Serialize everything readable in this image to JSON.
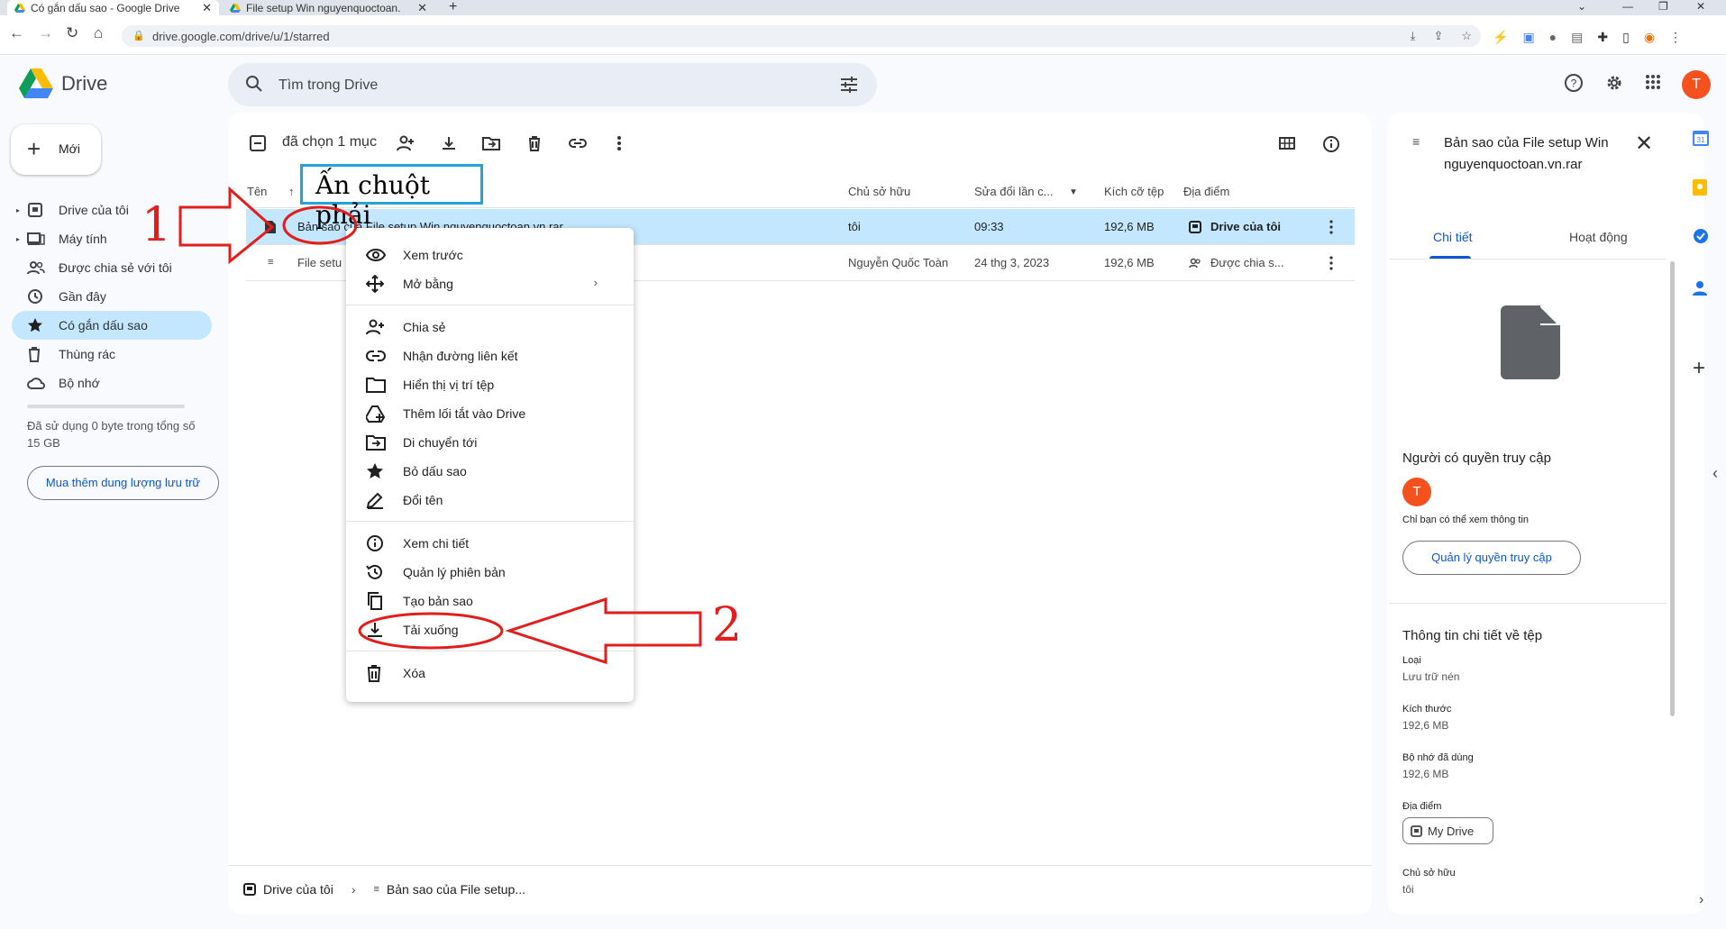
{
  "browser": {
    "tabs": [
      {
        "title": "Có gắn dấu sao - Google Drive",
        "active": true
      },
      {
        "title": "File setup Win nguyenquoctoan.",
        "active": false
      }
    ],
    "url": "drive.google.com/drive/u/1/starred"
  },
  "app": {
    "name": "Drive",
    "search_placeholder": "Tìm trong Drive",
    "avatar_letter": "T"
  },
  "sidebar": {
    "new_label": "Mới",
    "items": [
      {
        "label": "Drive của tôi",
        "icon": "my-drive-icon"
      },
      {
        "label": "Máy tính",
        "icon": "computer-icon"
      },
      {
        "label": "Được chia sẻ với tôi",
        "icon": "shared-icon"
      },
      {
        "label": "Gần đây",
        "icon": "clock-icon"
      },
      {
        "label": "Có gắn dấu sao",
        "icon": "star-icon",
        "active": true
      },
      {
        "label": "Thùng rác",
        "icon": "trash-icon"
      },
      {
        "label": "Bộ nhớ",
        "icon": "cloud-icon"
      }
    ],
    "storage_text": "Đã sử dụng 0 byte trong tổng số 15 GB",
    "buy_label": "Mua thêm dung lượng lưu trữ"
  },
  "toolbar": {
    "selection_text": "đã chọn 1 mục"
  },
  "table": {
    "headers": {
      "name": "Tên",
      "owner": "Chủ sở hữu",
      "modified": "Sửa đổi lần c...",
      "size": "Kích cỡ tệp",
      "location": "Địa điểm"
    },
    "rows": [
      {
        "name": "Bản sao của File setup Win nguyenquoctoan.vn.rar",
        "owner": "tôi",
        "modified": "09:33",
        "size": "192,6 MB",
        "location": "Drive của tôi",
        "selected": true
      },
      {
        "name": "File setu",
        "owner": "Nguyễn Quốc Toàn",
        "modified": "24 thg 3, 2023",
        "size": "192,6 MB",
        "location": "Được chia s...",
        "selected": false
      }
    ]
  },
  "annotation": {
    "box_text": "Ấn chuột phải",
    "num1": "1",
    "num2": "2"
  },
  "context_menu": {
    "items": [
      {
        "label": "Xem trước",
        "icon": "eye-icon"
      },
      {
        "label": "Mở bằng",
        "icon": "move-arrows-icon",
        "submenu": true
      },
      {
        "label": "Chia sẻ",
        "icon": "person-add-icon"
      },
      {
        "label": "Nhận đường liên kết",
        "icon": "link-icon"
      },
      {
        "label": "Hiển thị vị trí tệp",
        "icon": "folder-icon"
      },
      {
        "label": "Thêm lối tắt vào Drive",
        "icon": "add-shortcut-icon"
      },
      {
        "label": "Di chuyển tới",
        "icon": "move-folder-icon"
      },
      {
        "label": "Bỏ dấu sao",
        "icon": "star-icon"
      },
      {
        "label": "Đổi tên",
        "icon": "pencil-icon"
      },
      {
        "label": "Xem chi tiết",
        "icon": "info-icon"
      },
      {
        "label": "Quản lý phiên bản",
        "icon": "history-icon"
      },
      {
        "label": "Tạo bản sao",
        "icon": "copy-icon"
      },
      {
        "label": "Tải xuống",
        "icon": "download-icon"
      },
      {
        "label": "Xóa",
        "icon": "trash-icon"
      }
    ]
  },
  "details": {
    "title": "Bản sao của File setup Win nguyenquoctoan.vn.rar",
    "tab_details": "Chi tiết",
    "tab_activity": "Hoạt động",
    "access_heading": "Người có quyền truy cập",
    "access_note": "Chỉ bạn có thể xem thông tin",
    "manage_label": "Quản lý quyền truy cập",
    "info_heading": "Thông tin chi tiết về tệp",
    "type_label": "Loại",
    "type_value": "Lưu trữ nén",
    "size_label": "Kích thước",
    "size_value": "192,6 MB",
    "storage_label": "Bộ nhớ đã dùng",
    "storage_value": "192,6 MB",
    "location_label": "Địa điểm",
    "location_value": "My Drive",
    "owner_label": "Chủ sở hữu",
    "owner_value": "tôi",
    "avatar_letter": "T"
  },
  "breadcrumb": {
    "root": "Drive của tôi",
    "current": "Bản sao của File setup..."
  },
  "colors": {
    "selected_row": "#c2e7ff",
    "accent": "#0b57d0",
    "annotation_red": "#e31c1c",
    "annotation_box": "#20a4db",
    "avatar": "#f4511e"
  }
}
